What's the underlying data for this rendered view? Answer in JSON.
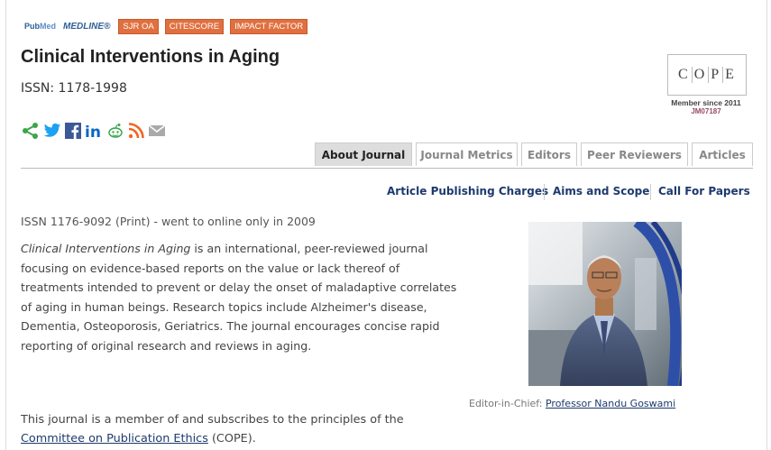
{
  "badges": {
    "pubmed_a": "Pub",
    "pubmed_b": "Med",
    "medline": "MEDLINE®",
    "sjr": "SJR OA",
    "citescore": "CITESCORE",
    "impact": "IMPACT FACTOR"
  },
  "journal": {
    "title": "Clinical Interventions in Aging",
    "issn": "ISSN: 1178-1998"
  },
  "cope": {
    "letters": [
      "C",
      "O",
      "P",
      "E"
    ],
    "member_since": "Member since 2011",
    "id": "JM07187"
  },
  "social_icons": [
    "share-icon",
    "twitter-icon",
    "facebook-icon",
    "linkedin-icon",
    "reddit-icon",
    "rss-icon",
    "email-icon"
  ],
  "tabs": [
    {
      "label": "About Journal",
      "active": true
    },
    {
      "label": "Journal Metrics",
      "active": false
    },
    {
      "label": "Editors",
      "active": false
    },
    {
      "label": "Peer Reviewers",
      "active": false
    },
    {
      "label": "Articles",
      "active": false
    }
  ],
  "sublinks": [
    "Article Publishing Charges",
    "Aims and Scope",
    "Call For Papers"
  ],
  "content": {
    "issn_print": "ISSN 1176-9092 (Print) - went to online only in 2009",
    "desc_title": "Clinical Interventions in Aging",
    "desc_body": " is an international, peer-reviewed journal focusing on evidence-based reports on the value or lack thereof of treatments intended to prevent or delay the onset of maladaptive correlates of aging in human beings. Research topics include Alzheimer's disease, Dementia, Osteoporosis, Geriatrics. The journal encourages concise rapid reporting of original research and reviews in aging.",
    "caption_label": "Editor-in-Chief: ",
    "caption_name": "Professor Nandu Goswami",
    "member_text": "This journal is a member of and subscribes to the principles of the",
    "cope_link": "Committee on Publication Ethics",
    "cope_suffix": " (COPE)."
  },
  "colors": {
    "badge_orange": "#e07040",
    "link_blue": "#1d3a6e",
    "share_green": "#3aa64a",
    "twitter_blue": "#1da1f2",
    "facebook_blue": "#3b5998",
    "linkedin_blue": "#0a66c2",
    "rss_orange": "#f26522"
  }
}
